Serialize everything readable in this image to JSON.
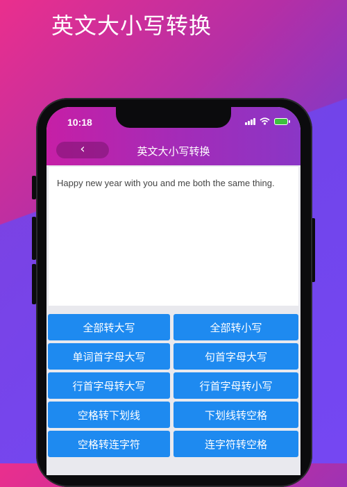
{
  "headline": "英文大小写转换",
  "status_bar": {
    "time": "10:18",
    "icons": [
      "signal-bars-icon",
      "wifi-icon",
      "battery-charging-icon"
    ]
  },
  "app_bar": {
    "back_label": "‹",
    "title": "英文大小写转换"
  },
  "editor": {
    "text": "Happy new year with you and me both the same thing."
  },
  "buttons": [
    {
      "label": "全部转大写"
    },
    {
      "label": "全部转小写"
    },
    {
      "label": "单词首字母大写"
    },
    {
      "label": "句首字母大写"
    },
    {
      "label": "行首字母转大写"
    },
    {
      "label": "行首字母转小写"
    },
    {
      "label": "空格转下划线"
    },
    {
      "label": "下划线转空格"
    },
    {
      "label": "空格转连字符"
    },
    {
      "label": "连字符转空格"
    }
  ],
  "colors": {
    "button": "#1e8af0",
    "appbar_start": "#c61fa6",
    "appbar_end": "#8a36c6"
  }
}
